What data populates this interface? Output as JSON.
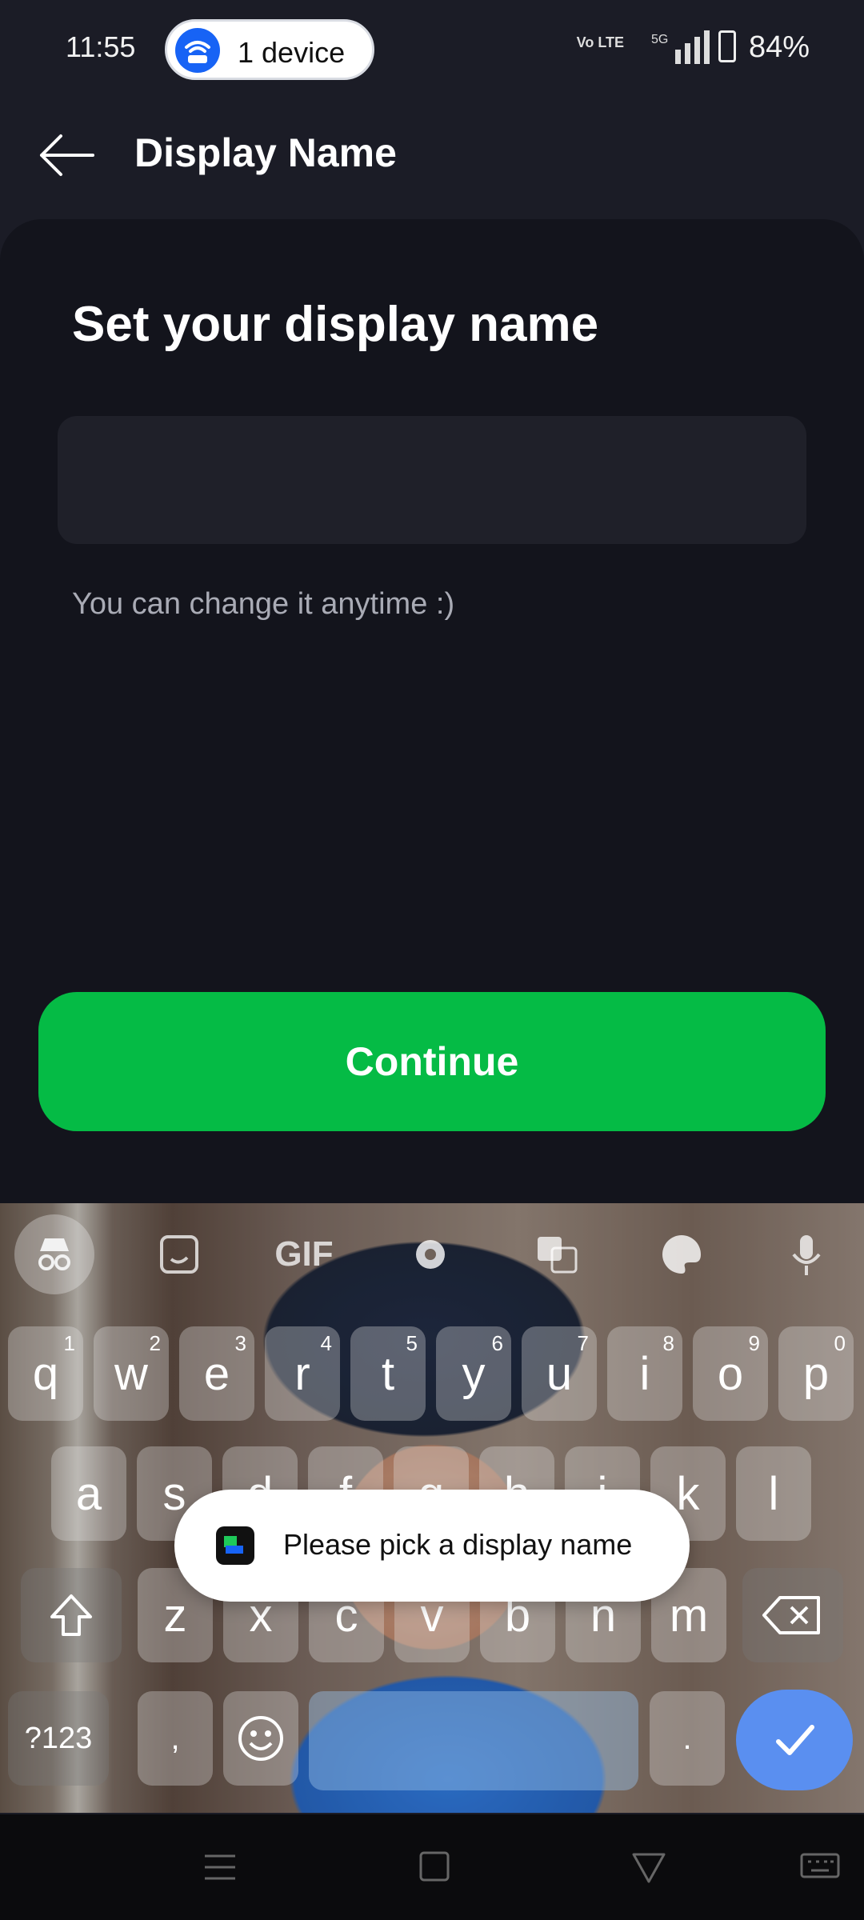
{
  "status_bar": {
    "time": "11:55",
    "device_pill": "1 device",
    "network_volte": "Vo LTE",
    "network_type": "5G",
    "battery": "84%"
  },
  "app_bar": {
    "title": "Display Name"
  },
  "form": {
    "heading": "Set your display name",
    "name_value": "",
    "name_placeholder": "",
    "hint": "You can change it anytime :)",
    "continue_label": "Continue"
  },
  "keyboard": {
    "toolbar": [
      "incognito-icon",
      "sticker-icon",
      "GIF",
      "settings-icon",
      "translate-icon",
      "palette-icon",
      "mic-icon"
    ],
    "gif_label": "GIF",
    "row1": [
      {
        "k": "q",
        "n": "1"
      },
      {
        "k": "w",
        "n": "2"
      },
      {
        "k": "e",
        "n": "3"
      },
      {
        "k": "r",
        "n": "4"
      },
      {
        "k": "t",
        "n": "5"
      },
      {
        "k": "y",
        "n": "6"
      },
      {
        "k": "u",
        "n": "7"
      },
      {
        "k": "i",
        "n": "8"
      },
      {
        "k": "o",
        "n": "9"
      },
      {
        "k": "p",
        "n": "0"
      }
    ],
    "row2": [
      "a",
      "s",
      "d",
      "f",
      "g",
      "h",
      "j",
      "k",
      "l"
    ],
    "row3": [
      "z",
      "x",
      "c",
      "v",
      "b",
      "n",
      "m"
    ],
    "symbols_label": "?123",
    "comma_label": ",",
    "period_label": "."
  },
  "toast": {
    "message": "Please pick a display name"
  },
  "colors": {
    "background": "#1b1c26",
    "sheet": "#13141c",
    "accent_green": "#05bb45",
    "pill_blue": "#1763f5",
    "enter_blue": "#5a8ff0"
  }
}
